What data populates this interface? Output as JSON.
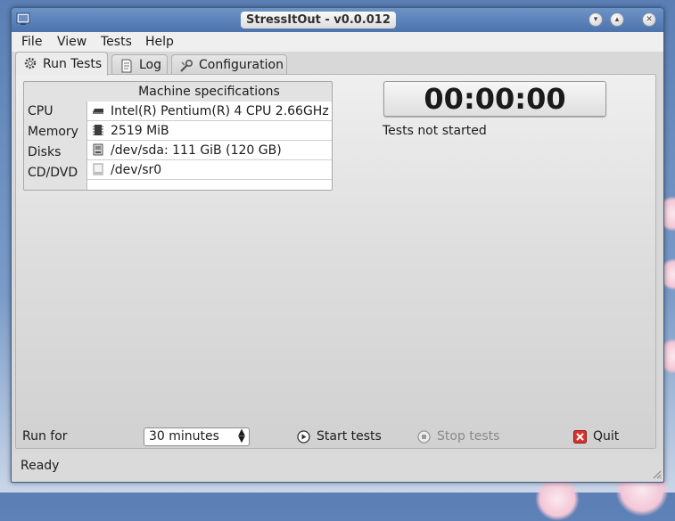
{
  "window": {
    "title": "StressItOut - v0.0.012"
  },
  "menu": {
    "items": [
      "File",
      "View",
      "Tests",
      "Help"
    ]
  },
  "tabs": [
    {
      "label": "Run Tests",
      "icon": "gear-icon",
      "active": true
    },
    {
      "label": "Log",
      "icon": "document-icon",
      "active": false
    },
    {
      "label": "Configuration",
      "icon": "wrench-icon",
      "active": false
    }
  ],
  "specs": {
    "header": "Machine specifications",
    "rows": [
      {
        "label": "CPU",
        "value": "Intel(R) Pentium(R) 4 CPU 2.66GHz",
        "icon": "cpu-icon"
      },
      {
        "label": "Memory",
        "value": "2519 MiB",
        "icon": "memory-chip-icon"
      },
      {
        "label": "Disks",
        "value": "/dev/sda: 111 GiB (120 GB)",
        "icon": "hard-disk-icon"
      },
      {
        "label": "CD/DVD",
        "value": "/dev/sr0",
        "icon": "optical-drive-icon"
      }
    ]
  },
  "timer": {
    "value": "00:00:00"
  },
  "test_status": "Tests not started",
  "controls": {
    "run_for_label": "Run for",
    "duration_selected": "30 minutes",
    "start_label": "Start tests",
    "stop_label": "Stop tests",
    "quit_label": "Quit"
  },
  "statusbar": {
    "text": "Ready"
  },
  "colors": {
    "titlebar": "#4d73ad",
    "quit_icon": "#d9342b",
    "disabled_text": "#8a8a8a"
  }
}
